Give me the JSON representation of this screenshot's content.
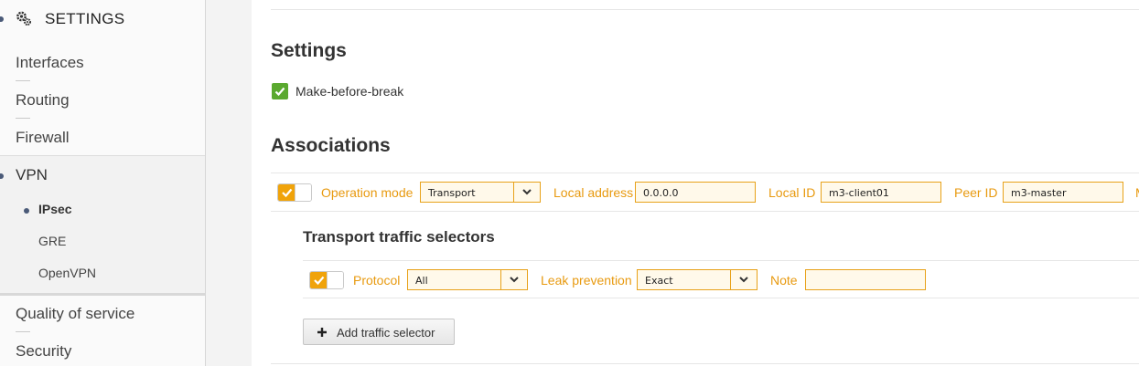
{
  "sidebar": {
    "section_title": "SETTINGS",
    "items": [
      "Interfaces",
      "Routing",
      "Firewall"
    ],
    "vpn": {
      "label": "VPN",
      "sub_items": [
        "IPsec",
        "GRE",
        "OpenVPN"
      ]
    },
    "items_after": [
      "Quality of service",
      "Security"
    ]
  },
  "settings": {
    "title": "Settings",
    "make_before_break_label": "Make-before-break",
    "make_before_break_checked": true
  },
  "associations": {
    "title": "Associations",
    "enabled": true,
    "operation_mode_label": "Operation mode",
    "operation_mode_value": "Transport",
    "local_address_label": "Local address",
    "local_address_value": "0.0.0.0",
    "local_id_label": "Local ID",
    "local_id_value": "m3-client01",
    "peer_id_label": "Peer ID",
    "peer_id_value": "m3-master",
    "truncated_next_label": "M"
  },
  "traffic_selectors": {
    "title": "Transport traffic selectors",
    "enabled": true,
    "protocol_label": "Protocol",
    "protocol_value": "All",
    "leak_prevention_label": "Leak prevention",
    "leak_prevention_value": "Exact",
    "note_label": "Note",
    "note_value": "",
    "add_button_label": "Add traffic selector"
  },
  "colors": {
    "accent": "#e89a10",
    "check_green": "#5aa92f",
    "sidebar_bullet": "#4a5a78"
  }
}
